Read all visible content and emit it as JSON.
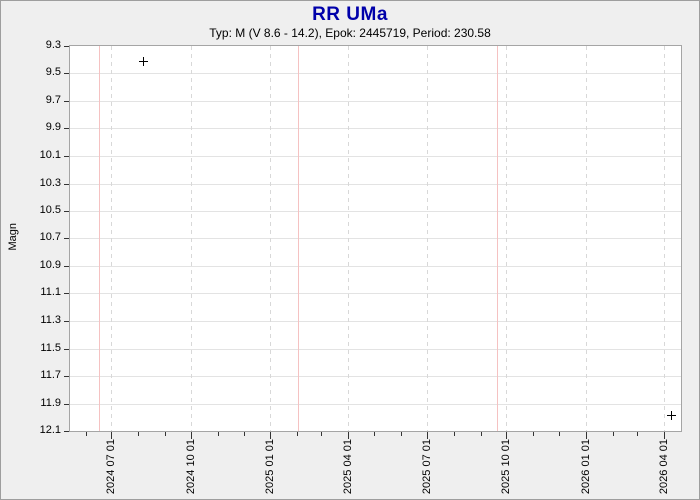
{
  "header": {
    "title": "RR UMa",
    "subtitle": "Typ: M (V 8.6 - 14.2), Epok: 2445719, Period: 230.58"
  },
  "chart_data": {
    "type": "scatter",
    "title": "RR UMa",
    "subtitle": "Typ: M (V 8.6 - 14.2), Epok: 2445719, Period: 230.58",
    "star": {
      "name": "RR UMa",
      "variable_type": "M",
      "v_magnitude_range": "8.6 - 14.2",
      "epoch": 2445719,
      "period_days": 230.58
    },
    "ylabel": "Magn",
    "y_axis": {
      "min": 9.3,
      "max": 12.1,
      "inverted_magnitude_scale": true,
      "ticks": [
        "9.3",
        "9.5",
        "9.7",
        "9.9",
        "10.1",
        "10.3",
        "10.5",
        "10.7",
        "10.9",
        "11.1",
        "11.3",
        "11.5",
        "11.7",
        "11.9",
        "12.1"
      ]
    },
    "x_axis": {
      "range": [
        "2024-05-14",
        "2026-04-21"
      ],
      "minor_tick_interval": "1 month",
      "major_ticks": [
        {
          "date": "2024-07-01",
          "label": "2024 07 01"
        },
        {
          "date": "2024-10-01",
          "label": "2024 10 01"
        },
        {
          "date": "2025-01-01",
          "label": "2025 01 01"
        },
        {
          "date": "2025-04-01",
          "label": "2025 04 01"
        },
        {
          "date": "2025-07-01",
          "label": "2025 07 01"
        },
        {
          "date": "2025-10-01",
          "label": "2025 10 01"
        },
        {
          "date": "2026-01-01",
          "label": "2026 01 01"
        },
        {
          "date": "2026-04-01",
          "label": "2026 04 01"
        }
      ]
    },
    "points": [
      {
        "date": "2024-08-06",
        "magnitude": 9.41,
        "marker": "plus"
      },
      {
        "date": "2026-04-09",
        "magnitude": 11.98,
        "marker": "plus"
      }
    ],
    "period_lines": {
      "dates": [
        "2024-06-16",
        "2025-02-02",
        "2025-09-20"
      ]
    },
    "grid": {
      "horizontal": "solid",
      "vertical_major": "dashed",
      "legend": "none"
    },
    "colors": {
      "title": "#0000aa",
      "background": "#efefef",
      "plot_background": "#ffffff",
      "plot_border": "#a5a5a5",
      "h_grid": "#e3e3e3",
      "v_grid": "#d8d8d8",
      "period_line": "#f5c2c2",
      "marker": "#000000"
    }
  }
}
